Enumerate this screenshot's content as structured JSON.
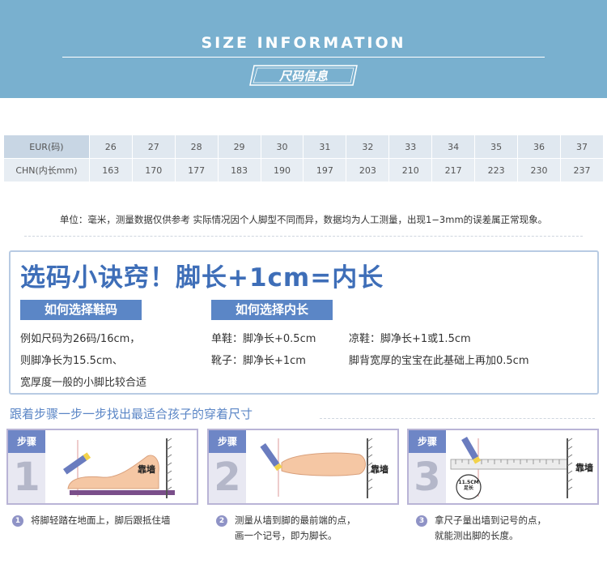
{
  "header": {
    "title": "SIZE INFORMATION",
    "subtitle": "尺码信息"
  },
  "size_table": {
    "eur_label": "EUR(码)",
    "chn_label": "CHN(内长mm)",
    "eur": [
      "26",
      "27",
      "28",
      "29",
      "30",
      "31",
      "32",
      "33",
      "34",
      "35",
      "36",
      "37"
    ],
    "chn": [
      "163",
      "170",
      "177",
      "183",
      "190",
      "197",
      "203",
      "210",
      "217",
      "223",
      "230",
      "237"
    ]
  },
  "note": "单位：毫米，测量数据仅供参考 实际情况因个人脚型不同而异，数据均为人工测量，出现1−3mm的误差属正常现象。",
  "tips": {
    "title": "选码小诀窍！脚长+1cm=内长",
    "pill_left": "如何选择鞋码",
    "pill_right": "如何选择内长",
    "left_lines": [
      "例如尺码为26码/16cm，",
      "则脚净长为15.5cm、",
      "宽厚度一般的小脚比较合适"
    ],
    "single_shoe": "单鞋：脚净长+0.5cm",
    "boots": "靴子：脚净长+1cm",
    "sandals": "凉鞋：脚净长+1或1.5cm",
    "wide_feet": "脚背宽厚的宝宝在此基础上再加0.5cm"
  },
  "steps": {
    "title": "跟着步骤一步一步找出最适合孩子的穿着尺寸",
    "label": "步骤",
    "wall": "靠墙",
    "ruler_tag": [
      "11.5CM",
      "足长"
    ],
    "items": [
      {
        "num": "1",
        "caption": [
          "将脚轻踏在地面上，脚后跟抵住墙"
        ]
      },
      {
        "num": "2",
        "caption": [
          "测量从墙到脚的最前端的点，",
          "画一个记号，即为脚长。"
        ]
      },
      {
        "num": "3",
        "caption": [
          "拿尺子量出墙到记号的点，",
          "就能测出脚的长度。"
        ]
      }
    ]
  }
}
